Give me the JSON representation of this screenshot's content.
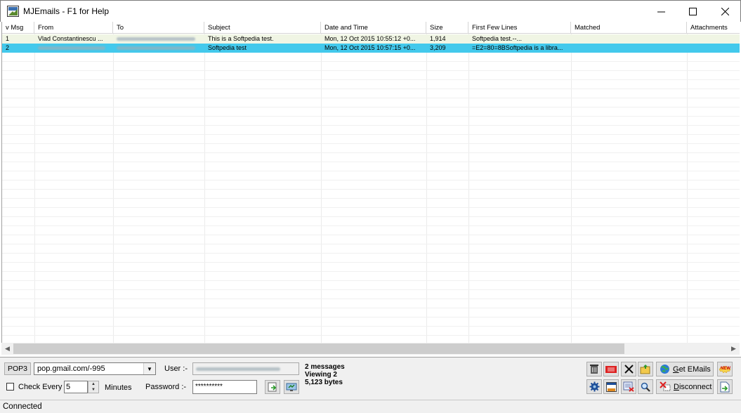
{
  "window": {
    "title": "MJEmails - F1 for Help"
  },
  "list": {
    "columns": [
      {
        "key": "msg",
        "label": "v Msg"
      },
      {
        "key": "from",
        "label": "From"
      },
      {
        "key": "to",
        "label": "To"
      },
      {
        "key": "subject",
        "label": "Subject"
      },
      {
        "key": "date",
        "label": "Date and Time"
      },
      {
        "key": "size",
        "label": "Size"
      },
      {
        "key": "lines",
        "label": "First Few Lines"
      },
      {
        "key": "matched",
        "label": "Matched"
      },
      {
        "key": "attachments",
        "label": "Attachments"
      }
    ],
    "rows": [
      {
        "msg": "1",
        "from": "Vlad Constantinescu ...",
        "to": "",
        "subject": "This is a Softpedia test.",
        "date": "Mon, 12 Oct 2015 10:55:12 +0...",
        "size": "1,914",
        "lines": "Softpedia test.--...",
        "matched": "",
        "attachments": "",
        "selected": false
      },
      {
        "msg": "2",
        "from": "",
        "to": "",
        "subject": "Softpedia test",
        "date": "Mon, 12 Oct 2015 10:57:15 +0...",
        "size": "3,209",
        "lines": "=E2=80=8BSoftpedia is a libra...",
        "matched": "",
        "attachments": "",
        "selected": true
      }
    ],
    "selected_color": "#43c9ec"
  },
  "panel": {
    "protocol_button": "POP3",
    "server": "pop.gmail.com/-995",
    "user_label": "User :-",
    "password_label": "Password :-",
    "password_value": "**********",
    "check_every_label": "Check Every",
    "check_every_value": "5",
    "minutes_label": "Minutes",
    "status_messages": "2 messages",
    "status_viewing": "Viewing 2",
    "status_bytes": "5,123 bytes",
    "get_emails_label": "Get EMails",
    "get_emails_hotkey": "G",
    "disconnect_label": "Disconnect",
    "disconnect_hotkey": "D",
    "new_badge": "NEW"
  },
  "statusbar": {
    "text": "Connected"
  }
}
